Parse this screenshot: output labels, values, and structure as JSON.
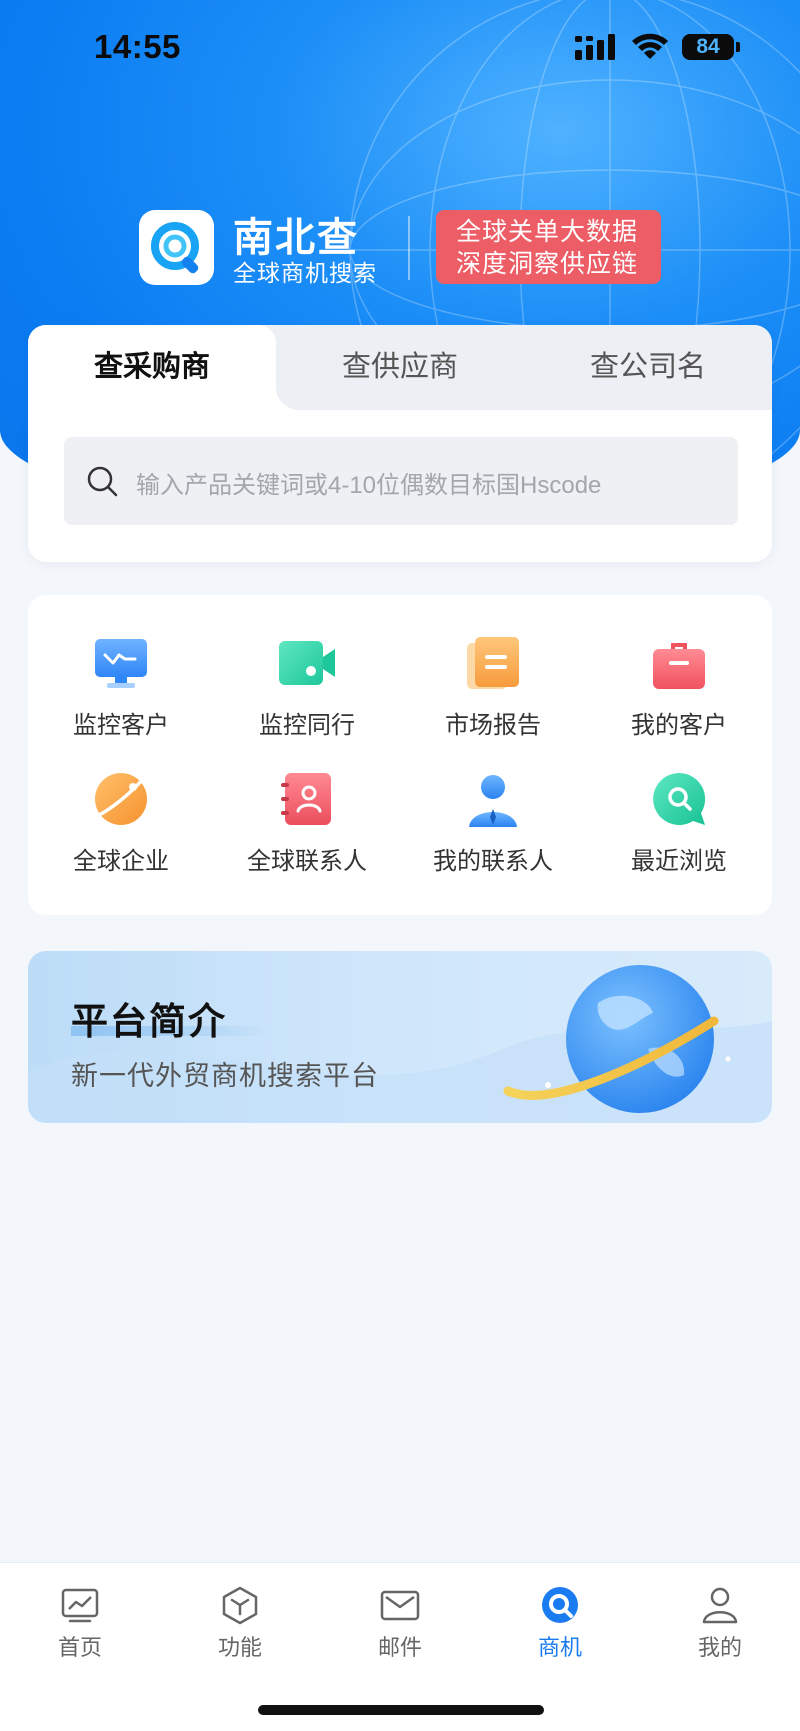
{
  "status_bar": {
    "time": "14:55",
    "battery": "84"
  },
  "brand": {
    "name": "南北查",
    "subtitle": "全球商机搜索",
    "promo_line1": "全球关单大数据",
    "promo_line2": "深度洞察供应链"
  },
  "search": {
    "tabs": [
      {
        "label": "查采购商",
        "active": true
      },
      {
        "label": "查供应商",
        "active": false
      },
      {
        "label": "查公司名",
        "active": false
      }
    ],
    "placeholder": "输入产品关键词或4-10位偶数目标国Hscode"
  },
  "features": [
    {
      "label": "监控客户",
      "icon": "monitor-icon"
    },
    {
      "label": "监控同行",
      "icon": "video-icon"
    },
    {
      "label": "市场报告",
      "icon": "report-icon"
    },
    {
      "label": "我的客户",
      "icon": "briefcase-icon"
    },
    {
      "label": "全球企业",
      "icon": "planet-icon"
    },
    {
      "label": "全球联系人",
      "icon": "contact-book-icon"
    },
    {
      "label": "我的联系人",
      "icon": "person-icon"
    },
    {
      "label": "最近浏览",
      "icon": "search-bubble-icon"
    }
  ],
  "intro": {
    "title": "平台简介",
    "subtitle": "新一代外贸商机搜索平台"
  },
  "bottom_nav": [
    {
      "label": "首页",
      "icon": "chart-icon",
      "active": false
    },
    {
      "label": "功能",
      "icon": "cube-icon",
      "active": false
    },
    {
      "label": "邮件",
      "icon": "mail-icon",
      "active": false
    },
    {
      "label": "商机",
      "icon": "search-icon",
      "active": true
    },
    {
      "label": "我的",
      "icon": "user-icon",
      "active": false
    }
  ],
  "colors": {
    "primary": "#1a7cf0",
    "promo": "#ec5d66",
    "background": "#f3f6fb"
  }
}
